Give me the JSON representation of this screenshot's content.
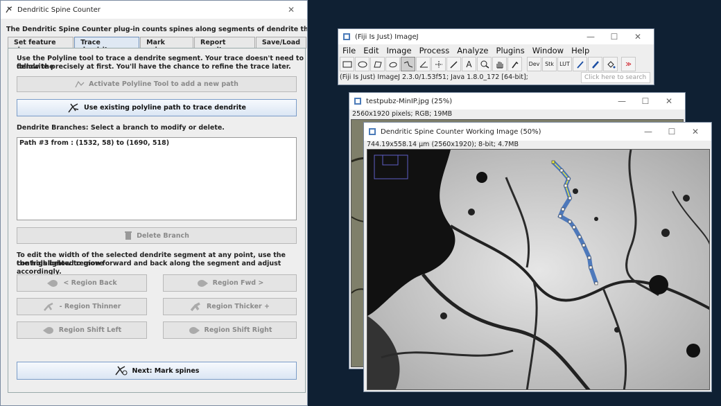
{
  "dialog": {
    "title": "Dendritic Spine Counter",
    "intro": "The Dendritic Spine Counter plug-in counts spines along segments of dendrite that you specify.",
    "tabs": [
      "Set feature size",
      "Trace dendrites",
      "Mark spines",
      "Report results",
      "Save/Load"
    ],
    "active_tab": "Trace dendrites",
    "instructions1_line1": "Use the Polyline tool to trace a dendrite segment. Your trace doesn't need to follow the",
    "instructions1_line2": "dendrite precisely at first. You'll have the chance to refine the trace later.",
    "activate_button": "Activate Polyline Tool to add a new path",
    "use_existing_button": "Use existing polyline path to trace dendrite",
    "branches_label": "Dendrite Branches: Select a branch to modify or delete.",
    "branches": [
      "Path #3 from : (1532, 58) to (1690, 518)"
    ],
    "delete_button": "Delete Branch",
    "instructions2_line1": "To edit the width of the selected dendrite segment at any point, use the controls below to move",
    "instructions2_line2": "the highlighted region forward and back along the segment and adjust accordingly.",
    "region_back": "< Region Back",
    "region_fwd": "Region Fwd >",
    "region_thinner": "- Region Thinner",
    "region_thicker": "Region Thicker +",
    "region_shift_left": "Region Shift Left",
    "region_shift_right": "Region Shift Right",
    "next_button": "Next: Mark spines"
  },
  "imagej": {
    "title": "(Fiji Is Just) ImageJ",
    "menu": [
      "File",
      "Edit",
      "Image",
      "Process",
      "Analyze",
      "Plugins",
      "Window",
      "Help"
    ],
    "tools": [
      "rectangle-tool",
      "oval-tool",
      "polygon-tool",
      "freehand-tool",
      "polyline-tool",
      "angle-tool",
      "point-tool",
      "wand-tool",
      "text-tool",
      "zoom-tool",
      "hand-tool",
      "color-picker-tool",
      "dev-menu",
      "stk-menu",
      "lut-menu",
      "pencil-tool",
      "brush-tool",
      "flood-fill-tool",
      "more-tools"
    ],
    "tool_labels": {
      "dev": "Dev",
      "stk": "Stk",
      "lut": "LUT",
      "text": "A",
      "more": "≫"
    },
    "status": "(Fiji Is Just) ImageJ 2.3.0/1.53f51; Java 1.8.0_172 [64-bit];",
    "search_placeholder": "Click here to search"
  },
  "image1": {
    "title": "testpubz-MinIP.jpg (25%)",
    "info": "2560x1920 pixels; RGB; 19MB"
  },
  "image2": {
    "title": "Dendritic Spine Counter Working Image (50%)",
    "info": "744.19x558.14 µm (2560x1920); 8-bit; 4.7MB"
  },
  "colors": {
    "desktop": "#0f2033",
    "accent_tab": "#dfe8f3",
    "trace_blue": "#3f6fb8",
    "trace_yellow": "#e8e84a",
    "more_tools_red": "#d0202a"
  }
}
